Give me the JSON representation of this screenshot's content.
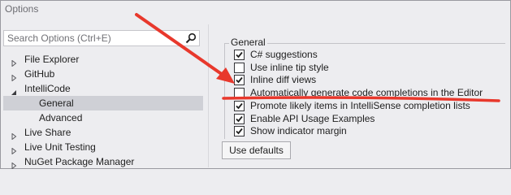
{
  "window": {
    "title": "Options"
  },
  "search": {
    "placeholder": "Search Options (Ctrl+E)",
    "value": "",
    "icon": "search-icon"
  },
  "tree": {
    "items": [
      {
        "label": "File Explorer",
        "level": 0,
        "expanded": false,
        "selected": false
      },
      {
        "label": "GitHub",
        "level": 0,
        "expanded": false,
        "selected": false
      },
      {
        "label": "IntelliCode",
        "level": 0,
        "expanded": true,
        "selected": false
      },
      {
        "label": "General",
        "level": 1,
        "expanded": null,
        "selected": true
      },
      {
        "label": "Advanced",
        "level": 1,
        "expanded": null,
        "selected": false
      },
      {
        "label": "Live Share",
        "level": 0,
        "expanded": false,
        "selected": false
      },
      {
        "label": "Live Unit Testing",
        "level": 0,
        "expanded": false,
        "selected": false
      },
      {
        "label": "NuGet Package Manager",
        "level": 0,
        "expanded": false,
        "selected": false
      }
    ]
  },
  "general": {
    "title": "General",
    "options": [
      {
        "label": "C# suggestions",
        "checked": true
      },
      {
        "label": "Use inline tip style",
        "checked": false
      },
      {
        "label": "Inline diff views",
        "checked": true
      },
      {
        "label": "Automatically generate code completions in the Editor",
        "checked": false
      },
      {
        "label": "Promote likely items in IntelliSense completion lists",
        "checked": true
      },
      {
        "label": "Enable API Usage Examples",
        "checked": true
      },
      {
        "label": "Show indicator margin",
        "checked": true
      }
    ]
  },
  "buttons": {
    "use_defaults": "Use defaults"
  },
  "colors": {
    "annotation": "#e8382c",
    "selection": "#cfd0d6",
    "window_background": "#ededf0"
  }
}
